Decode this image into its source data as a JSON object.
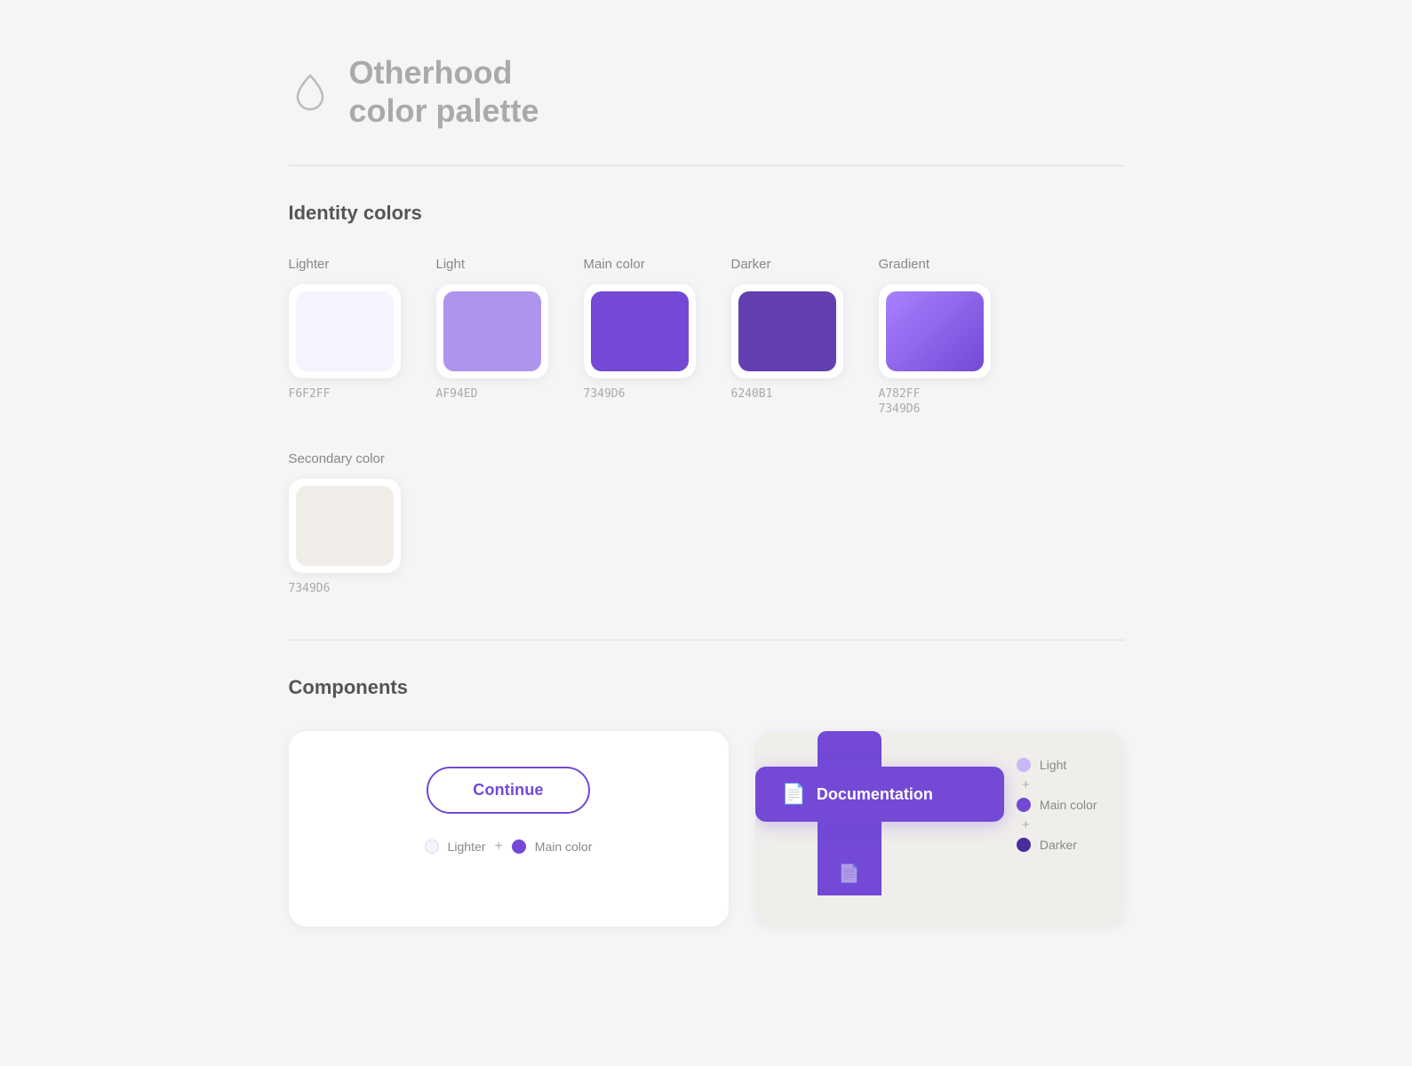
{
  "header": {
    "title_line1": "Otherhood",
    "title_line2": "color palette",
    "icon": "droplet"
  },
  "identity_section": {
    "title": "Identity colors",
    "colors": [
      {
        "label": "Lighter",
        "hex": "F6F2FF",
        "color_value": "#F6F2FF",
        "is_gradient": false
      },
      {
        "label": "Light",
        "hex": "AF94ED",
        "color_value": "#AF94ED",
        "is_gradient": false
      },
      {
        "label": "Main color",
        "hex": "7349D6",
        "color_value": "#7349D6",
        "is_gradient": false
      },
      {
        "label": "Darker",
        "hex": "6240B1",
        "color_value": "#6240B1",
        "is_gradient": false
      },
      {
        "label": "Gradient",
        "hex1": "A782FF",
        "hex2": "7349D6",
        "color_value": "gradient",
        "is_gradient": true
      },
      {
        "label": "Secondary color",
        "hex": "7349D6",
        "color_value": "#F0EDE8",
        "is_gradient": false
      }
    ]
  },
  "components_section": {
    "title": "Components",
    "card1": {
      "button_label": "Continue",
      "legend": [
        {
          "label": "Lighter",
          "type": "lighter"
        },
        {
          "label": "+",
          "type": "plus"
        },
        {
          "label": "Main color",
          "type": "main"
        }
      ]
    },
    "card2": {
      "doc_button_label": "Documentation",
      "legend": [
        {
          "label": "Light",
          "type": "light"
        },
        {
          "label": "+",
          "type": "plus"
        },
        {
          "label": "Main color",
          "type": "main"
        },
        {
          "label": "+",
          "type": "plus"
        },
        {
          "label": "Darker",
          "type": "darker"
        }
      ]
    }
  }
}
